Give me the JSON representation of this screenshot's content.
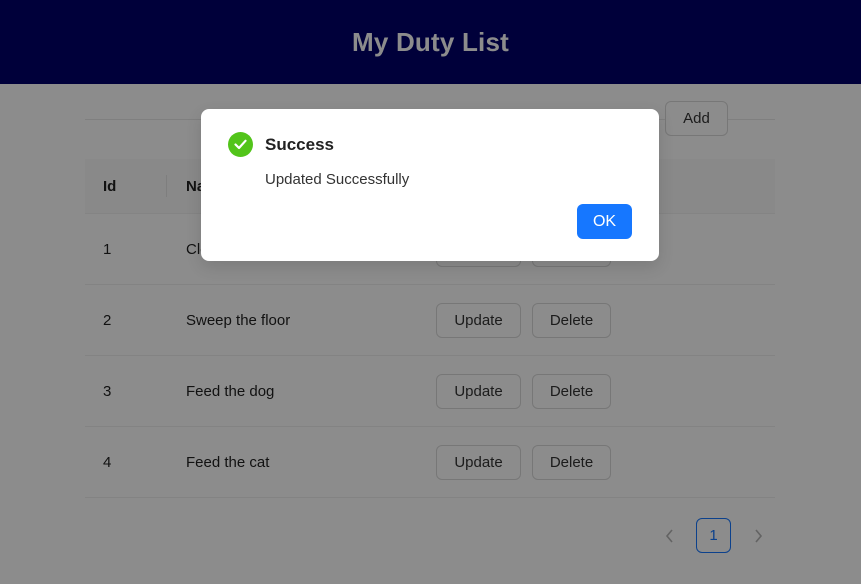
{
  "header": {
    "title": "My Duty List"
  },
  "toolbar": {
    "add_label": "Add"
  },
  "table": {
    "columns": [
      "Id",
      "Name"
    ],
    "rows": [
      {
        "id": "1",
        "name": "Clean the house",
        "update": "Update",
        "delete": "Delete"
      },
      {
        "id": "2",
        "name": "Sweep the floor",
        "update": "Update",
        "delete": "Delete"
      },
      {
        "id": "3",
        "name": "Feed the dog",
        "update": "Update",
        "delete": "Delete"
      },
      {
        "id": "4",
        "name": "Feed the cat",
        "update": "Update",
        "delete": "Delete"
      }
    ]
  },
  "pagination": {
    "current": "1",
    "prev_icon": "chevron-left-icon",
    "next_icon": "chevron-right-icon"
  },
  "modal": {
    "icon": "check-circle-icon",
    "title": "Success",
    "message": "Updated Successfully",
    "ok_label": "OK"
  },
  "colors": {
    "header_bg": "#00006b",
    "primary": "#1677ff",
    "success": "#52c41a"
  }
}
